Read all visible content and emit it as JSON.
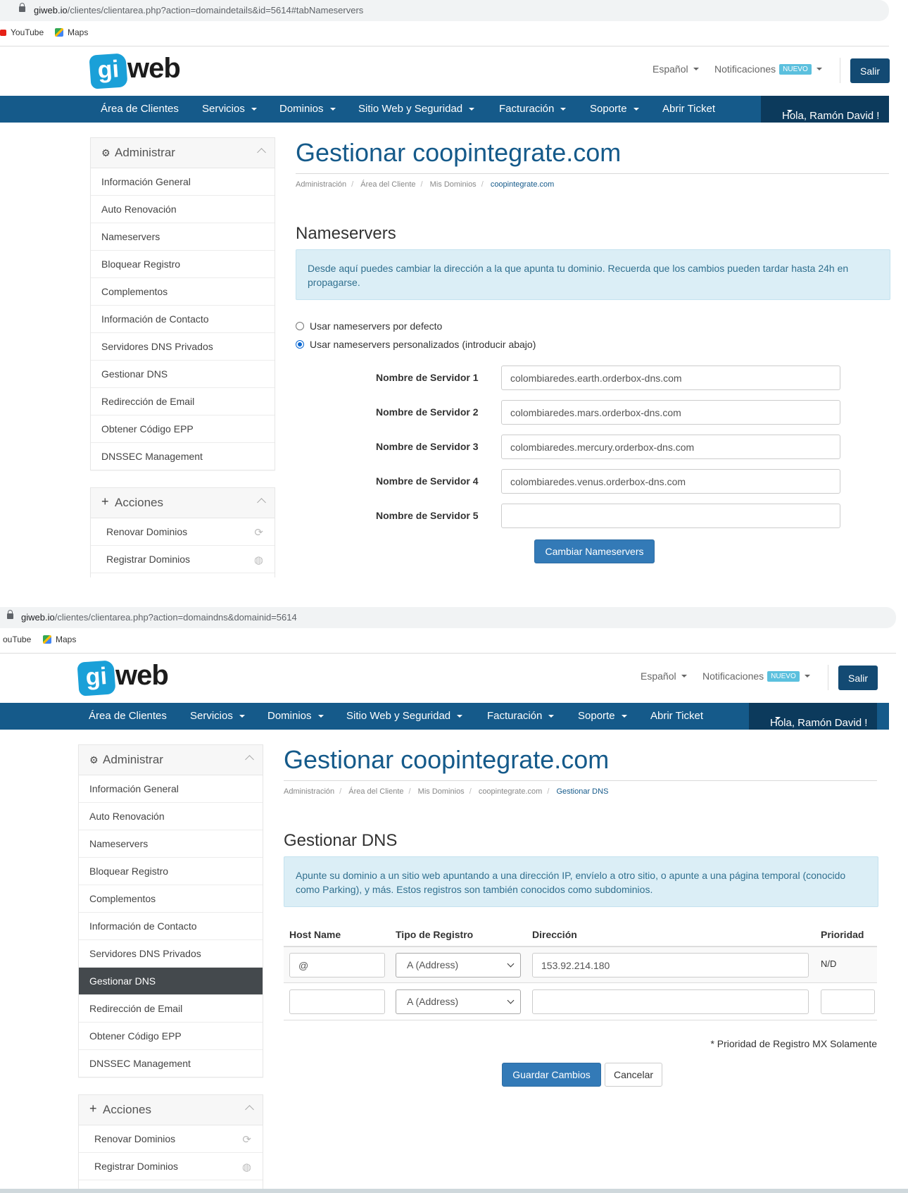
{
  "shot1": {
    "url_host": "giweb.io",
    "url_path": "/clientes/clientarea.php?action=domaindetails&id=5614#tabNameservers",
    "bookmarks": [
      "YouTube",
      "Maps"
    ],
    "header": {
      "language": "Español",
      "notifications": "Notificaciones",
      "badge": "NUEVO",
      "logout": "Salir",
      "logo_gi": "gi",
      "logo_web": "web"
    },
    "nav": [
      "Área de Clientes",
      "Servicios",
      "Dominios",
      "Sitio Web y Seguridad",
      "Facturación",
      "Soporte",
      "Abrir Ticket"
    ],
    "greeting": "Hola, Ramón David !",
    "sidebar": {
      "title": "Administrar",
      "items": [
        "Información General",
        "Auto Renovación",
        "Nameservers",
        "Bloquear Registro",
        "Complementos",
        "Información de Contacto",
        "Servidores DNS Privados",
        "Gestionar DNS",
        "Redirección de Email",
        "Obtener Código EPP",
        "DNSSEC Management"
      ],
      "actions_title": "Acciones",
      "actions": [
        "Renovar Dominios",
        "Registrar Dominios"
      ]
    },
    "title": "Gestionar coopintegrate.com",
    "breadcrumb": [
      "Administración",
      "Área del Cliente",
      "Mis Dominios",
      "coopintegrate.com"
    ],
    "section": "Nameservers",
    "info": "Desde aquí puedes cambiar la dirección a la que apunta tu dominio. Recuerda que los cambios pueden tardar hasta 24h en propagarse.",
    "radio_default": "Usar nameservers por defecto",
    "radio_custom": "Usar nameservers personalizados (introducir abajo)",
    "servers": [
      {
        "label": "Nombre de Servidor 1",
        "value": "colombiaredes.earth.orderbox-dns.com"
      },
      {
        "label": "Nombre de Servidor 2",
        "value": "colombiaredes.mars.orderbox-dns.com"
      },
      {
        "label": "Nombre de Servidor 3",
        "value": "colombiaredes.mercury.orderbox-dns.com"
      },
      {
        "label": "Nombre de Servidor 4",
        "value": "colombiaredes.venus.orderbox-dns.com"
      },
      {
        "label": "Nombre de Servidor 5",
        "value": ""
      }
    ],
    "submit": "Cambiar Nameservers"
  },
  "shot2": {
    "url_host": "giweb.io",
    "url_path": "/clientes/clientarea.php?action=domaindns&domainid=5614",
    "bookmarks": [
      "ouTube",
      "Maps"
    ],
    "title": "Gestionar coopintegrate.com",
    "breadcrumb": [
      "Administración",
      "Área del Cliente",
      "Mis Dominios",
      "coopintegrate.com",
      "Gestionar DNS"
    ],
    "section": "Gestionar DNS",
    "info": "Apunte su dominio a un sitio web apuntando a una dirección IP, envíelo a otro sitio, o apunte a una página temporal (conocido como Parking), y más. Estos registros son también conocidos como subdominios.",
    "columns": [
      "Host Name",
      "Tipo de Registro",
      "Dirección",
      "Prioridad"
    ],
    "rows": [
      {
        "host": "@",
        "type": "A (Address)",
        "address": "153.92.214.180",
        "priority": "N/D"
      },
      {
        "host": "",
        "type": "A (Address)",
        "address": "",
        "priority": ""
      }
    ],
    "note": "* Prioridad de Registro MX Solamente",
    "save": "Guardar Cambios",
    "cancel": "Cancelar"
  }
}
